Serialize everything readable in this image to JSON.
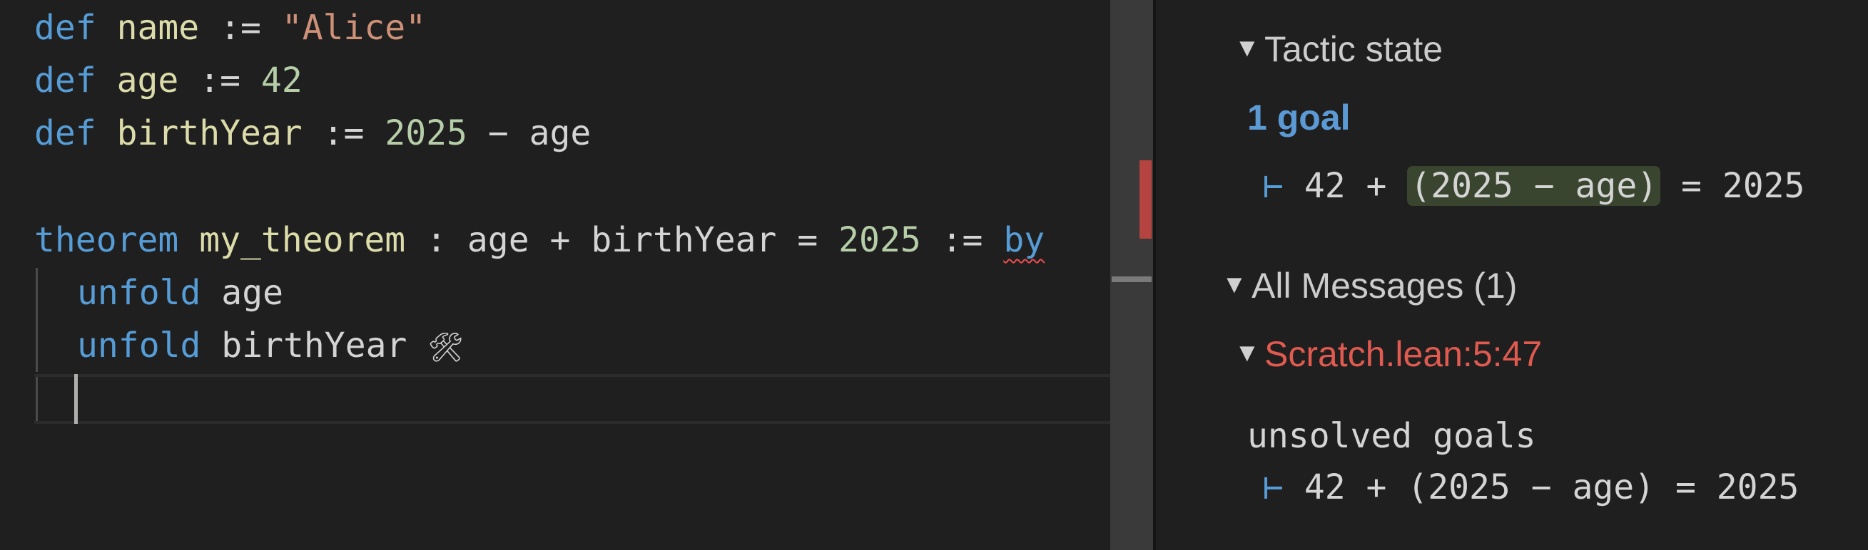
{
  "editor": {
    "lines": [
      {
        "kw": "def",
        "name": "name",
        "op": ":=",
        "value": "\"Alice\""
      },
      {
        "kw": "def",
        "name": "age",
        "op": ":=",
        "value": "42"
      },
      {
        "kw": "def",
        "name": "birthYear",
        "op": ":=",
        "value": "2025",
        "minus": "−",
        "rhs": "age"
      },
      {
        "kw": "theorem",
        "name": "my_theorem",
        "colon": ":",
        "lhs1": "age",
        "plus": "+",
        "lhs2": "birthYear",
        "eq": "=",
        "value": "2025",
        "assign": ":=",
        "by": "by"
      },
      {
        "kw": "unfold",
        "arg": "age"
      },
      {
        "kw": "unfold",
        "arg": "birthYear",
        "icon": "🛠"
      }
    ]
  },
  "infoview": {
    "tactic_state": {
      "toggle": "▼",
      "title": "Tactic state",
      "goal_count": "1 goal",
      "goal": {
        "turnstile": "⊢",
        "a": "42",
        "plus": "+",
        "paren": "(2025 − age)",
        "eq": "=",
        "rhs": "2025"
      }
    },
    "all_messages": {
      "toggle": "▼",
      "title": "All Messages (1)"
    },
    "message": {
      "toggle": "▼",
      "location": "Scratch.lean:5:47",
      "text": "unsolved goals",
      "goal": {
        "turnstile": "⊢",
        "expr": "42 + (2025 − age) = 2025"
      }
    }
  },
  "colors": {
    "keyword": "#569cd6",
    "function": "#dcdcaa",
    "string": "#ce9178",
    "number": "#b5cea8",
    "error": "#e05a50",
    "goal_count": "#5c9ad6"
  }
}
